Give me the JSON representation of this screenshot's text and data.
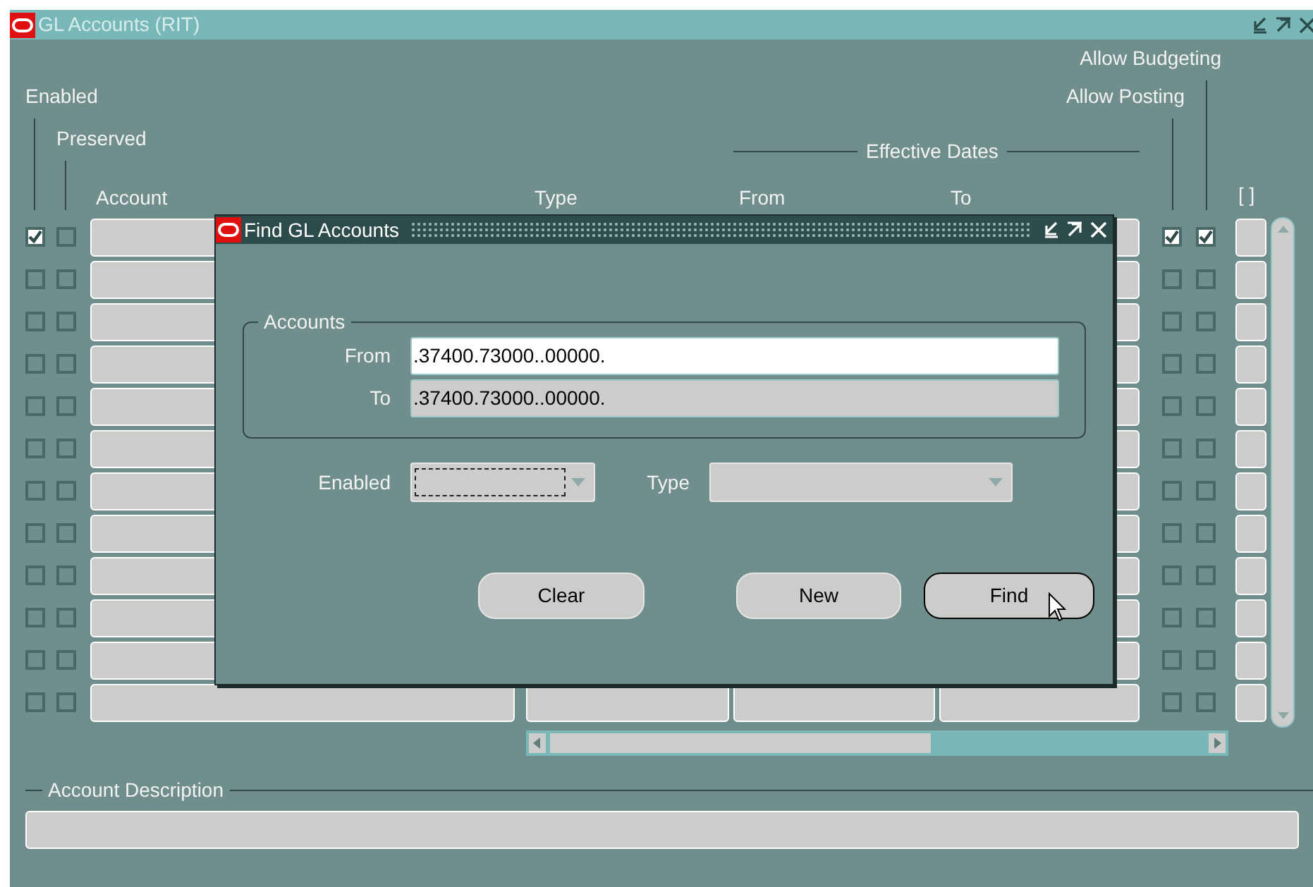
{
  "window": {
    "title": "GL Accounts (RIT)"
  },
  "headers": {
    "enabled": "Enabled",
    "preserved": "Preserved",
    "account": "Account",
    "type": "Type",
    "effective_dates": "Effective Dates",
    "from": "From",
    "to": "To",
    "allow_posting": "Allow Posting",
    "allow_budgeting": "Allow Budgeting",
    "extra": "[ ]"
  },
  "rows": [
    {
      "enabled": true,
      "preserved": false,
      "allow_posting": true,
      "allow_budgeting": true
    },
    {
      "enabled": false,
      "preserved": false,
      "allow_posting": false,
      "allow_budgeting": false
    },
    {
      "enabled": false,
      "preserved": false,
      "allow_posting": false,
      "allow_budgeting": false
    },
    {
      "enabled": false,
      "preserved": false,
      "allow_posting": false,
      "allow_budgeting": false
    },
    {
      "enabled": false,
      "preserved": false,
      "allow_posting": false,
      "allow_budgeting": false
    },
    {
      "enabled": false,
      "preserved": false,
      "allow_posting": false,
      "allow_budgeting": false
    },
    {
      "enabled": false,
      "preserved": false,
      "allow_posting": false,
      "allow_budgeting": false
    },
    {
      "enabled": false,
      "preserved": false,
      "allow_posting": false,
      "allow_budgeting": false
    },
    {
      "enabled": false,
      "preserved": false,
      "allow_posting": false,
      "allow_budgeting": false
    },
    {
      "enabled": false,
      "preserved": false,
      "allow_posting": false,
      "allow_budgeting": false
    },
    {
      "enabled": false,
      "preserved": false,
      "allow_posting": false,
      "allow_budgeting": false
    },
    {
      "enabled": false,
      "preserved": false,
      "allow_posting": false,
      "allow_budgeting": false
    }
  ],
  "dialog": {
    "title": "Find GL Accounts",
    "group": "Accounts",
    "fields": [
      {
        "label": "From",
        "value": ".37400.73000..00000.",
        "focused": true
      },
      {
        "label": "To",
        "value": ".37400.73000..00000.",
        "focused": false
      }
    ],
    "dropdowns": [
      {
        "label": "Enabled",
        "focused": true
      },
      {
        "label": "Type",
        "focused": false
      }
    ],
    "buttons": [
      {
        "label": "Clear",
        "default": false
      },
      {
        "label": "New",
        "default": false
      },
      {
        "label": "Find",
        "default": true
      }
    ]
  },
  "description": {
    "label": "Account Description"
  }
}
